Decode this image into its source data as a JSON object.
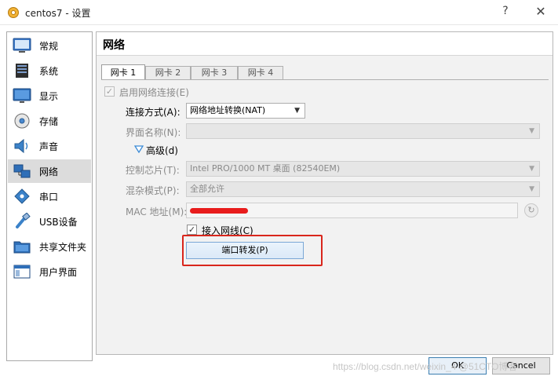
{
  "window": {
    "title": "centos7 - 设置",
    "help_glyph": "?",
    "close_glyph": "✕"
  },
  "sidebar": {
    "items": [
      {
        "label": "常规",
        "icon": "general-icon"
      },
      {
        "label": "系统",
        "icon": "system-icon"
      },
      {
        "label": "显示",
        "icon": "display-icon"
      },
      {
        "label": "存储",
        "icon": "storage-icon"
      },
      {
        "label": "声音",
        "icon": "audio-icon"
      },
      {
        "label": "网络",
        "icon": "network-icon",
        "active": true
      },
      {
        "label": "串口",
        "icon": "serial-port-icon"
      },
      {
        "label": "USB设备",
        "icon": "usb-icon"
      },
      {
        "label": "共享文件夹",
        "icon": "shared-folder-icon"
      },
      {
        "label": "用户界面",
        "icon": "user-interface-icon"
      }
    ]
  },
  "section": {
    "title": "网络"
  },
  "tabs": [
    {
      "label": "网卡 1",
      "active": true
    },
    {
      "label": "网卡 2"
    },
    {
      "label": "网卡 3"
    },
    {
      "label": "网卡 4"
    }
  ],
  "adapter": {
    "enable_label": "启用网络连接(E)",
    "enable_checked": true,
    "attached_to_label": "连接方式(A):",
    "attached_to_value": "网络地址转换(NAT)",
    "name_label": "界面名称(N):",
    "name_value": "",
    "advanced_label": "高级(d)",
    "chip_label": "控制芯片(T):",
    "chip_value": "Intel PRO/1000 MT 桌面 (82540EM)",
    "promisc_label": "混杂模式(P):",
    "promisc_value": "全部允许",
    "mac_label": "MAC 地址(M):",
    "cable_label": "接入网线(C)",
    "cable_checked": true,
    "port_forward_label": "端口转发(P)",
    "check_glyph": "✓",
    "arrow_glyph": "▼",
    "refresh_glyph": "↻"
  },
  "dialog": {
    "ok_label": "OK",
    "cancel_label": "Cancel"
  },
  "watermark": "https://blog.csdn.net/weixin_4 @51CTO博客",
  "colors": {
    "highlight": "#d9261c",
    "active_item": "#dcdcdc",
    "mac_redaction": "#e81c1c"
  }
}
